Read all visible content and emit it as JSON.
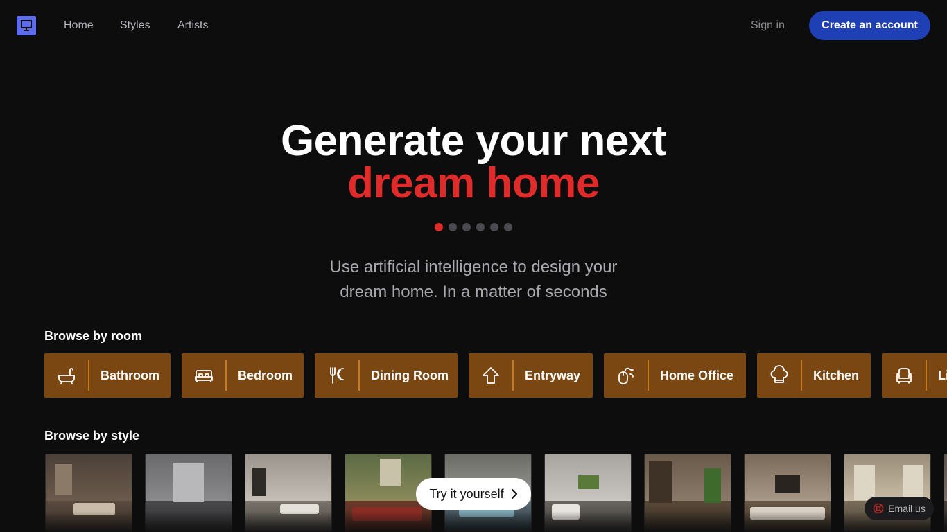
{
  "nav": {
    "logo_icon": "monitor-icon",
    "links": [
      "Home",
      "Styles",
      "Artists"
    ],
    "signin_label": "Sign in",
    "create_label": "Create an account"
  },
  "hero": {
    "line1": "Generate your next",
    "line2": "dream home",
    "carousel": {
      "total": 6,
      "active_index": 0
    },
    "subtitle_line1": "Use artificial intelligence to design your",
    "subtitle_line2": "dream home. In a matter of seconds"
  },
  "browse_room": {
    "title": "Browse by room",
    "items": [
      {
        "label": "Bathroom",
        "icon": "bathtub-icon"
      },
      {
        "label": "Bedroom",
        "icon": "bed-icon"
      },
      {
        "label": "Dining Room",
        "icon": "utensils-icon"
      },
      {
        "label": "Entryway",
        "icon": "house-arrow-icon"
      },
      {
        "label": "Home Office",
        "icon": "mouse-pointer-icon"
      },
      {
        "label": "Kitchen",
        "icon": "chef-hat-icon"
      },
      {
        "label": "Li",
        "icon": "armchair-icon"
      }
    ]
  },
  "browse_style": {
    "title": "Browse by style",
    "thumbnails": 10
  },
  "try_label": "Try it yourself",
  "email_label": "Email us",
  "colors": {
    "background": "#0d0d0e",
    "accent_red": "#e02b2b",
    "room_bg": "#7a4713",
    "room_divider": "#c77b1f",
    "primary_button": "#1f3fb5",
    "logo": "#5b6cf0"
  }
}
